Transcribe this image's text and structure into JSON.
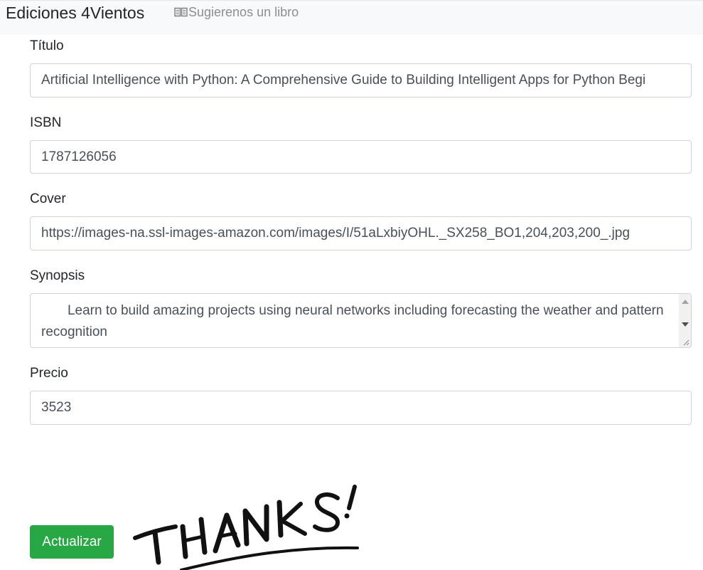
{
  "navbar": {
    "brand": "Ediciones 4Vientos",
    "suggest_link": "Sugierenos un libro",
    "suggest_icon": "book-icon"
  },
  "form": {
    "titulo": {
      "label": "Título",
      "value": "Artificial Intelligence with Python: A Comprehensive Guide to Building Intelligent Apps for Python Begi"
    },
    "isbn": {
      "label": "ISBN",
      "value": "1787126056"
    },
    "cover": {
      "label": "Cover",
      "value": "https://images-na.ssl-images-amazon.com/images/I/51aLxbiyOHL._SX258_BO1,204,203,200_.jpg"
    },
    "synopsis": {
      "label": "Synopsis",
      "value": "       Learn to build amazing projects using neural networks including forecasting the weather and pattern recognition"
    },
    "precio": {
      "label": "Precio",
      "value": "3523"
    },
    "submit_label": "Actualizar"
  },
  "decoration": {
    "image": "thanks-lettering",
    "text": "THANKS!"
  },
  "colors": {
    "navbar_bg": "#f8f9fa",
    "button_bg": "#28a745",
    "border": "#ced4da"
  }
}
